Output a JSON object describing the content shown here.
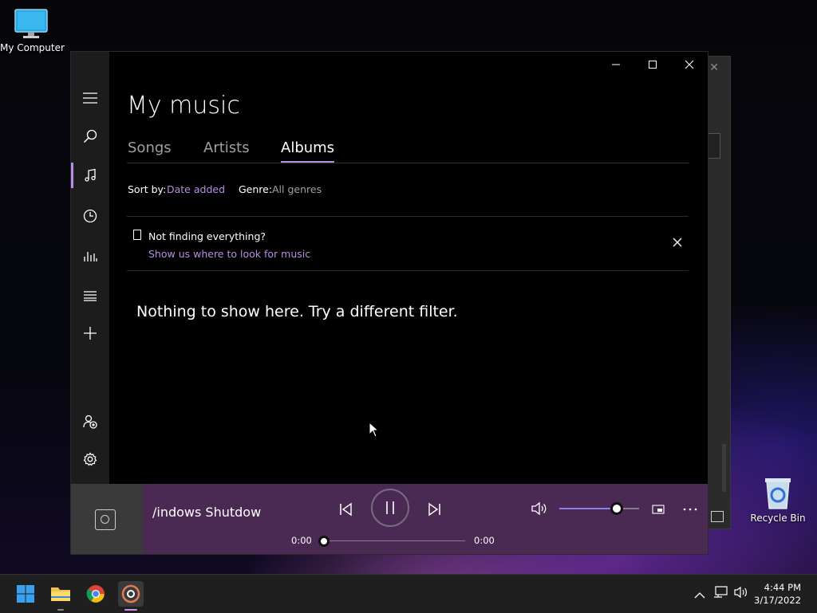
{
  "desktop": {
    "icons": [
      {
        "label": "My Computer",
        "icon": "monitor-icon"
      },
      {
        "label": "Recycle Bin",
        "icon": "recycle-bin-icon"
      }
    ]
  },
  "app": {
    "window_controls": {
      "minimize": "minimize-icon",
      "maximize": "maximize-icon",
      "close": "close-icon"
    },
    "nav_rail": [
      {
        "name": "menu",
        "icon": "hamburger-icon"
      },
      {
        "name": "search",
        "icon": "search-icon"
      },
      {
        "name": "my-music",
        "icon": "music-note-icon",
        "active": true
      },
      {
        "name": "recent",
        "icon": "clock-icon"
      },
      {
        "name": "now-playing",
        "icon": "equalizer-icon"
      },
      {
        "name": "playlists",
        "icon": "list-icon"
      },
      {
        "name": "new-playlist",
        "icon": "plus-icon"
      },
      {
        "name": "account",
        "icon": "person-add-icon"
      },
      {
        "name": "settings",
        "icon": "gear-icon"
      }
    ],
    "page_title": "My music",
    "tabs": [
      {
        "label": "Songs",
        "active": false
      },
      {
        "label": "Artists",
        "active": false
      },
      {
        "label": "Albums",
        "active": true
      }
    ],
    "filters": {
      "sort_label": "Sort by:",
      "sort_value": "Date added",
      "genre_label": "Genre:",
      "genre_value": "All genres"
    },
    "notice": {
      "title": "Not finding everything?",
      "link": "Show us where to look for music"
    },
    "empty_message": "Nothing to show here. Try a different filter.",
    "now_playing": {
      "title": "/indows Shutdow",
      "time_elapsed": "0:00",
      "time_total": "0:00",
      "progress": 0,
      "volume": 0.72
    }
  },
  "taskbar": {
    "apps": [
      {
        "name": "start",
        "icon": "windows-logo-icon"
      },
      {
        "name": "file-explorer",
        "icon": "folder-icon"
      },
      {
        "name": "chrome",
        "icon": "chrome-icon"
      },
      {
        "name": "groove-music",
        "icon": "groove-music-icon",
        "active": true
      }
    ],
    "time": "4:44 PM",
    "date": "3/17/2022"
  },
  "colors": {
    "accent": "#b68de4",
    "player_bar": "#4a2a52",
    "rail": "#1c1c1c"
  }
}
